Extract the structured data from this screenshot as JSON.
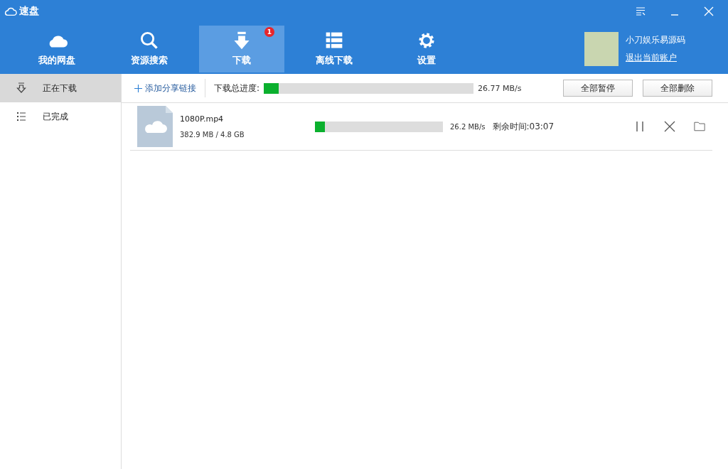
{
  "window": {
    "title": "速盘"
  },
  "nav": [
    {
      "label": "我的网盘",
      "kind": "cloud",
      "selected": false
    },
    {
      "label": "资源搜索",
      "kind": "search",
      "selected": false
    },
    {
      "label": "下载",
      "kind": "download",
      "selected": true,
      "badge": "1"
    },
    {
      "label": "离线下载",
      "kind": "list",
      "selected": false
    },
    {
      "label": "设置",
      "kind": "gear",
      "selected": false
    }
  ],
  "account": {
    "name": "小刀娱乐易源码",
    "logout": "退出当前账户"
  },
  "sidebar": {
    "items": [
      {
        "label": "正在下载",
        "kind": "download",
        "selected": true
      },
      {
        "label": "已完成",
        "kind": "list",
        "selected": false
      }
    ]
  },
  "toolbar": {
    "add_link": "添加分享链接",
    "total_label": "下载总进度:",
    "level": 0.07,
    "speed": "26.77 MB/s",
    "buttons": [
      "全部暂停",
      "全部删除"
    ]
  },
  "downloads": [
    {
      "name": "1080P.mp4",
      "size": "382.9 MB / 4.8 GB",
      "level": 0.08,
      "speed": "26.2 MB/s",
      "remaining": "剩余时间:03:07"
    }
  ]
}
